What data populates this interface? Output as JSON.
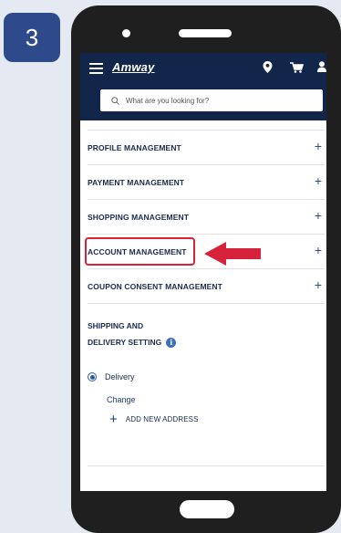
{
  "step": {
    "number": "3"
  },
  "header": {
    "logo": "Amway",
    "colors": {
      "bar": "#12254a"
    },
    "icons": [
      "menu-icon",
      "location-pin-icon",
      "cart-icon",
      "user-icon"
    ]
  },
  "search": {
    "placeholder": "What are you looking for?"
  },
  "menu": {
    "items": [
      {
        "label": "PROFILE MANAGEMENT"
      },
      {
        "label": "PAYMENT MANAGEMENT"
      },
      {
        "label": "SHOPPING MANAGEMENT"
      },
      {
        "label": "ACCOUNT MANAGEMENT",
        "highlighted": true
      },
      {
        "label": "COUPON CONSENT MANAGEMENT"
      }
    ],
    "expand_symbol": "+",
    "highlight_color": "#d6233b"
  },
  "shipping": {
    "title_line1": "SHIPPING AND",
    "title_line2": "DELIVERY SETTING",
    "info_symbol": "i",
    "option_label": "Delivery",
    "option_selected": true,
    "change_label": "Change",
    "add_symbol": "+",
    "add_label": "ADD NEW ADDRESS"
  }
}
